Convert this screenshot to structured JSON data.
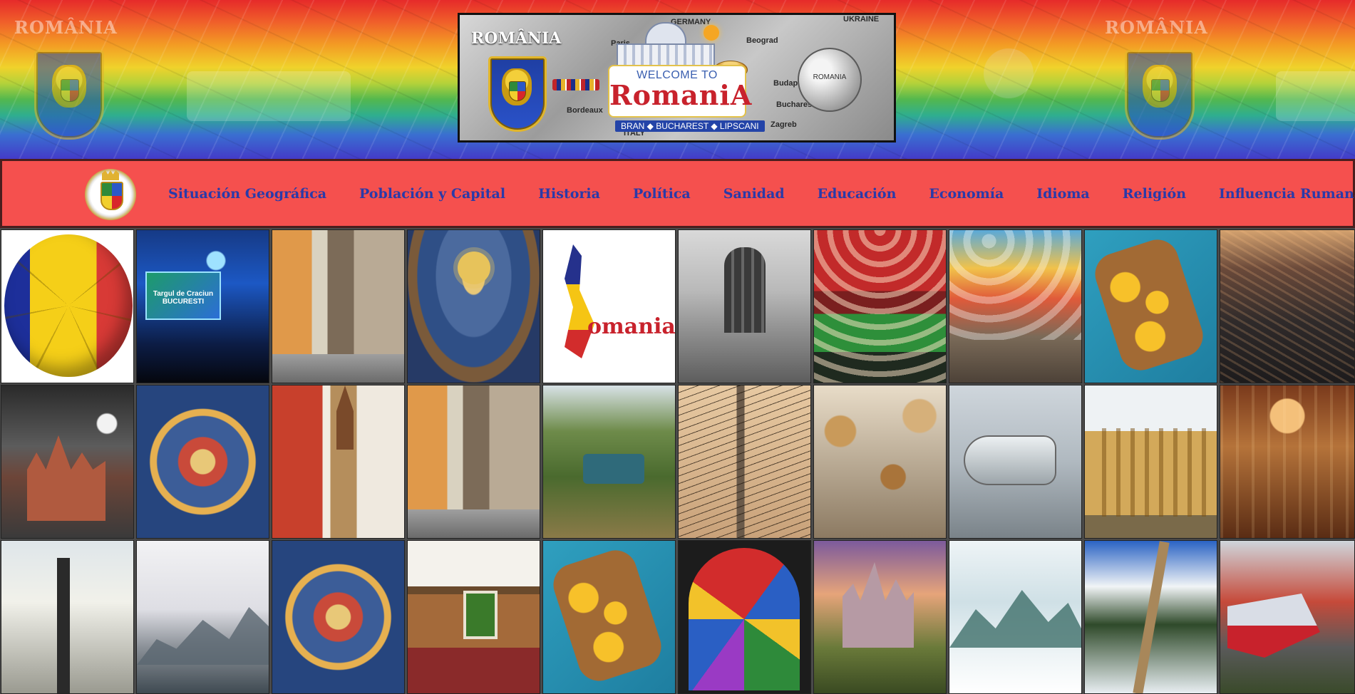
{
  "banner": {
    "ghost_title": "ROMÂNIA",
    "feature": {
      "title": "ROMÂNIA",
      "welcome_line": "WELCOME TO",
      "brand": "RomaniA",
      "places": "BRAN ◆ BUCHAREST ◆ LIPSCANI",
      "coin_text": "ROMANIA",
      "map_labels": [
        "GERMANY",
        "UKRAINE",
        "Budapest",
        "Bucharest",
        "Zagreb",
        "Beograd",
        "Paris",
        "ITALY",
        "Bordeaux"
      ]
    }
  },
  "nav": {
    "logo": "romanian-coat-of-arms",
    "items": [
      {
        "label": "Situación Geográfica"
      },
      {
        "label": "Población y Capital"
      },
      {
        "label": "Historia"
      },
      {
        "label": "Política"
      },
      {
        "label": "Sanidad"
      },
      {
        "label": "Educación"
      },
      {
        "label": "Economía"
      },
      {
        "label": "Idioma"
      },
      {
        "label": "Religión"
      },
      {
        "label": "Influencia Rumana"
      }
    ],
    "colors": {
      "bar": "#f5504e",
      "link": "#2a3aa8"
    }
  },
  "gallery": {
    "rows": [
      [
        "soccer-ball-flag",
        "concert-bucharest",
        "old-town-street",
        "church-fresco",
        "romania-logo",
        "heroes-monument",
        "red-umbrellas-street",
        "colorful-umbrellas",
        "traditional-food-platter",
        "city-aerial"
      ],
      [
        "castle-at-night",
        "painted-dome",
        "sighisoara-houses",
        "old-town-street-2",
        "abandoned-jeep",
        "tangled-wires",
        "cookies-market",
        "silver-airplane",
        "city-hall",
        "ornate-hall"
      ],
      [
        "street-with-lamp",
        "misty-mountains",
        "painted-dome-2",
        "traditional-interior",
        "traditional-food-platter-2",
        "stained-glass-window",
        "corvin-castle",
        "snowy-mountains",
        "forest-road",
        "red-trains"
      ]
    ],
    "tile_text": {
      "concert_screen": "Targul de Craciun BUCURESTI",
      "logo_word": "omania"
    }
  }
}
